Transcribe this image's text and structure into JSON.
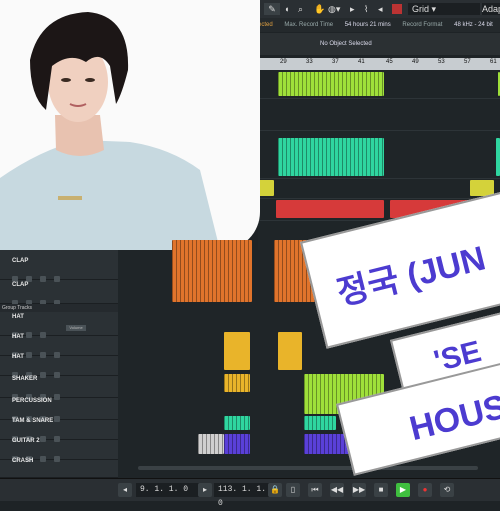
{
  "toolbar": {
    "grid_label": "Grid",
    "adapt_label": "Adapt to"
  },
  "status": {
    "selected": "ected",
    "max_record_label": "Max. Record Time",
    "max_record_value": "54 hours 21 mins",
    "format_label": "Record Format",
    "format_value": "48 kHz - 24 bit"
  },
  "info_line": "No Object Selected",
  "ruler": [
    "29",
    "33",
    "37",
    "41",
    "45",
    "49",
    "53",
    "57",
    "61"
  ],
  "tracks": {
    "clap_1": "CLAP",
    "clap_2": "CLAP",
    "group_header": "Group Tracks",
    "hat_group": "HAT",
    "volume": "Volume",
    "hat_1": "HAT",
    "hat_2": "HAT",
    "shaker": "SHAKER",
    "percussion": "PERCUSSION",
    "tam_snare": "TAM & SNARE",
    "guitar2": "GUITAR 2",
    "crash": "CRASH"
  },
  "transport": {
    "left_locator": "9. 1. 1.  0",
    "right_locator": "113. 1. 1.  0"
  },
  "overlay": {
    "line1": "정국 (JUN",
    "line2": "'SE",
    "line3": "HOUS"
  },
  "colors": {
    "lime": "#9fe03a",
    "teal": "#2fd6a0",
    "red": "#d63a3a",
    "orange": "#e0742c",
    "yellow": "#e9b42a",
    "purple": "#5a40d8",
    "overlay_text": "#4c3bd0"
  }
}
